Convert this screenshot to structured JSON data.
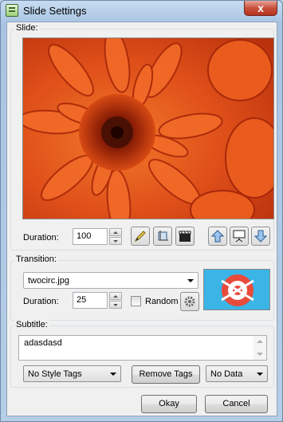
{
  "window": {
    "title": "Slide Settings",
    "icon": "slide-settings-app-icon",
    "close_icon": "close-x-icon",
    "close_glyph": "x"
  },
  "slide": {
    "label": "Slide:",
    "image_description": "orange chrysanthemum flower",
    "duration_label": "Duration:",
    "duration_value": "100",
    "tools": [
      {
        "name": "pencil-edit-icon"
      },
      {
        "name": "crop-image-icon"
      },
      {
        "name": "clapperboard-icon"
      },
      {
        "name": "move-up-icon"
      },
      {
        "name": "presentation-screen-icon"
      },
      {
        "name": "move-down-icon"
      }
    ]
  },
  "transition": {
    "label": "Transition:",
    "selected": "twocirc.jpg",
    "duration_label": "Duration:",
    "duration_value": "25",
    "random_label": "Random",
    "random_checked": false,
    "settings_icon": "gear-icon"
  },
  "subtitle": {
    "label": "Subtitle:",
    "text": "adasdasd",
    "style_tags_selected": "No Style Tags",
    "remove_tags_label": "Remove Tags",
    "data_selected": "No Data"
  },
  "buttons": {
    "okay": "Okay",
    "cancel": "Cancel"
  },
  "colors": {
    "flower_orange": "#e0501a",
    "titlebar": "#b9d1ea",
    "close_red": "#c9503c"
  }
}
